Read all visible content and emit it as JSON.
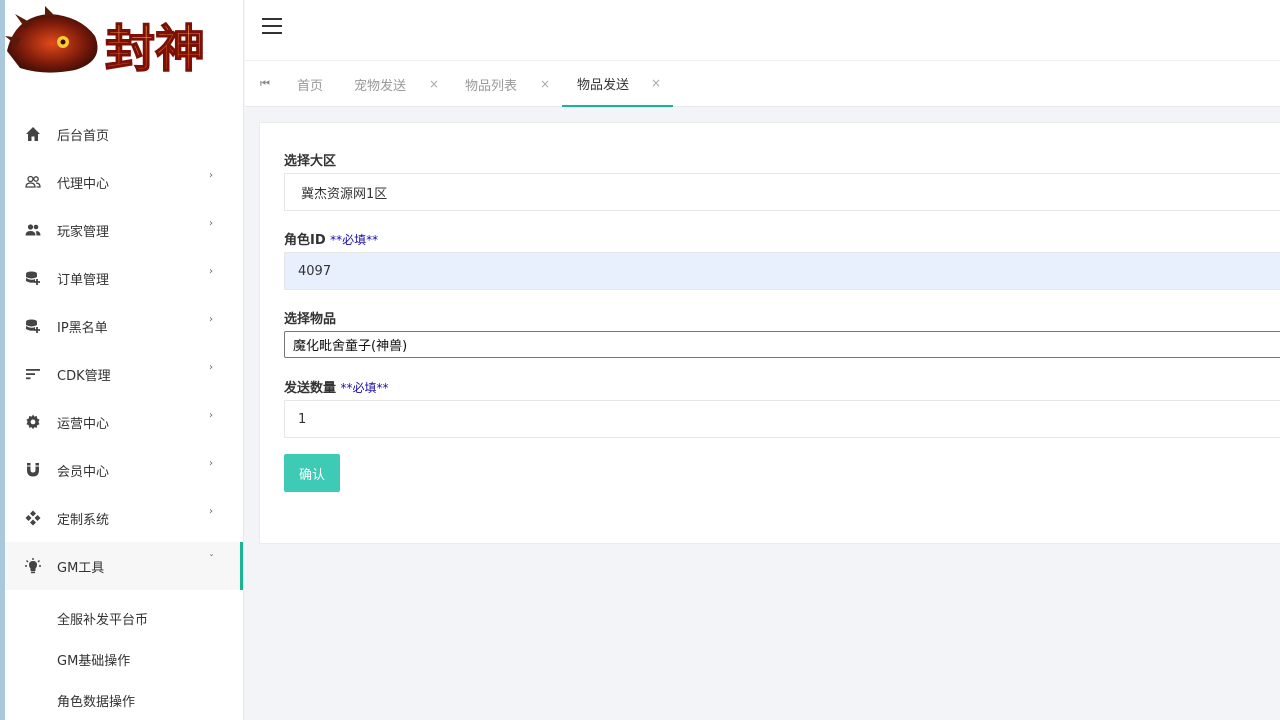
{
  "logo": {
    "text": "封神"
  },
  "sidebar": {
    "items": [
      {
        "label": "后台首页",
        "icon": "home-icon",
        "has_children": false
      },
      {
        "label": "代理中心",
        "icon": "users-outline-icon",
        "has_children": true
      },
      {
        "label": "玩家管理",
        "icon": "users-icon",
        "has_children": true
      },
      {
        "label": "订单管理",
        "icon": "database-plus-icon",
        "has_children": true
      },
      {
        "label": "IP黑名单",
        "icon": "database-plus-icon",
        "has_children": true
      },
      {
        "label": "CDK管理",
        "icon": "sort-icon",
        "has_children": true
      },
      {
        "label": "运营中心",
        "icon": "gear-icon",
        "has_children": true
      },
      {
        "label": "会员中心",
        "icon": "magnet-icon",
        "has_children": true
      },
      {
        "label": "定制系统",
        "icon": "puzzle-icon",
        "has_children": true
      },
      {
        "label": "GM工具",
        "icon": "bulb-icon",
        "has_children": true,
        "expanded": true
      }
    ],
    "arrow_collapsed": "›",
    "arrow_expanded": "ˇ",
    "submenu": [
      {
        "label": "全服补发平台币"
      },
      {
        "label": "GM基础操作"
      },
      {
        "label": "角色数据操作"
      }
    ]
  },
  "tabs": {
    "back_glyph": "⏮",
    "close_glyph": "×",
    "items": [
      {
        "label": "首页",
        "closable": false,
        "active": false
      },
      {
        "label": "宠物发送",
        "closable": true,
        "active": false
      },
      {
        "label": "物品列表",
        "closable": true,
        "active": false
      },
      {
        "label": "物品发送",
        "closable": true,
        "active": true
      }
    ]
  },
  "form": {
    "region": {
      "label": "选择大区",
      "value": "冀杰资源网1区"
    },
    "role_id": {
      "label": "角色ID",
      "required_note": "**必填**",
      "value": "4097"
    },
    "item": {
      "label": "选择物品",
      "selected": "魔化毗舍童子(神兽)"
    },
    "quantity": {
      "label": "发送数量",
      "required_note": "**必填**",
      "value": "1"
    },
    "submit_label": "确认"
  },
  "colors": {
    "accent": "#1ab394",
    "button": "#3dcbb5",
    "required_note": "#1a0dab",
    "autofill_bg": "#e8f0fe"
  }
}
